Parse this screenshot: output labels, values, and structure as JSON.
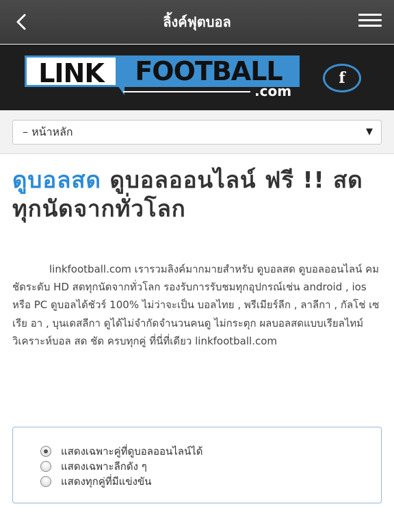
{
  "header": {
    "title": "ลิ้งค์ฟุตบอล",
    "back_icon": "chevron-left-icon",
    "menu_icon": "hamburger-menu-icon"
  },
  "banner": {
    "logo_part1": "LINK",
    "logo_part2": "FOOTBALL",
    "logo_suffix": ".com",
    "facebook_label": "f",
    "colors": {
      "accent": "#3b8fd0",
      "background": "#1e1e1e"
    }
  },
  "nav_select": {
    "selected": "– หน้าหลัก",
    "arrow": "▼"
  },
  "headline": {
    "highlight": "ดูบอลสด",
    "rest": " ดูบอลออนไลน์ ฟรี !! สดทุกนัดจากทั่วโลก",
    "highlight_color": "#2b8ad6"
  },
  "description": "linkfootball.com เรารวมลิงค์มากมายสำหรับ ดูบอลสด ดูบอลออนไลน์ คมชัดระดับ HD สดทุกนัดจากทั่วโลก รองรับการรับชมทุกอุปกรณ์เช่น android , ios หรือ PC ดูบอลได้ชัวร์ 100% ไม่ว่าจะเป็น บอลไทย , พรีเมียร์ลีก , ลาลีกา , กัลโช่ เซเรีย อา , บุนเดสลีกา ดูได้ไม่จำกัดจำนวนคนดู ไม่กระตุก ผลบอลสดแบบเรียลไทม์ วิเคราะห์บอล สด ชัด ครบทุกคู่ ที่นี่ที่เดียว linkfootball.com",
  "filter_options": [
    {
      "label": "แสดงเฉพาะคู่ที่ดูบอลออนไลน์ได้",
      "checked": true
    },
    {
      "label": "แสดงเฉพาะลีกดัง ๆ",
      "checked": false
    },
    {
      "label": "แสดงทุกคู่ที่มีแข่งขัน",
      "checked": false
    }
  ]
}
